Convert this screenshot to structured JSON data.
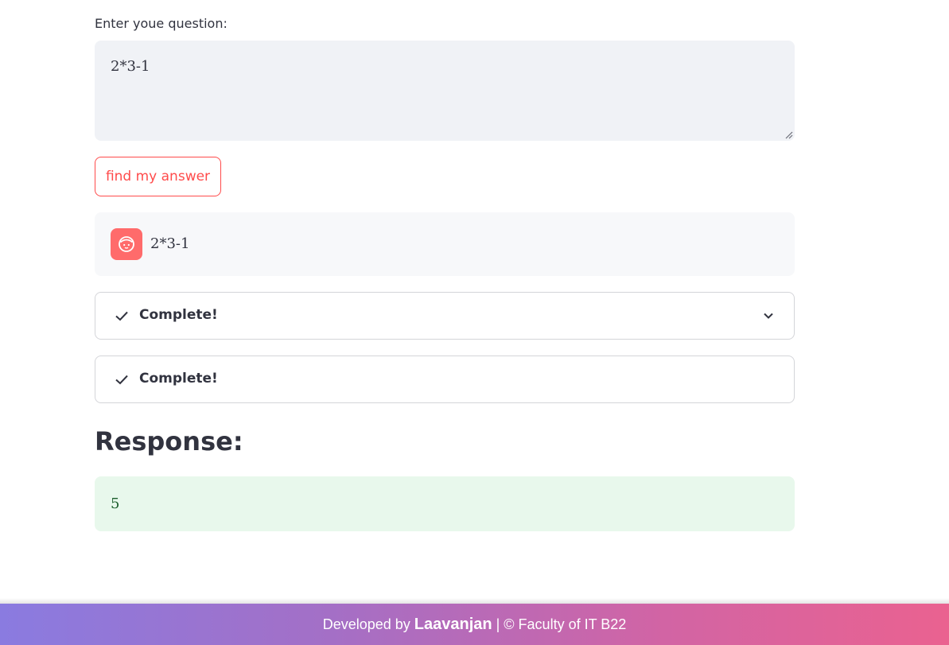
{
  "form": {
    "label": "Enter youe question:",
    "question_value": "2*3-1",
    "submit_label": "find my answer"
  },
  "chat": {
    "user_message": "2*3-1",
    "avatar_icon": "user-face-icon",
    "avatar_color": "#ff6b6b"
  },
  "status": [
    {
      "label": "Complete!",
      "icon": "check-icon",
      "expandable": true
    },
    {
      "label": "Complete!",
      "icon": "check-icon",
      "expandable": false
    }
  ],
  "response": {
    "heading": "Response:",
    "value": "5"
  },
  "footer": {
    "prefix": "Developed by",
    "author": "Laavanjan",
    "suffix": "| © Faculty of IT B22"
  },
  "colors": {
    "accent": "#ff4b4b",
    "success_bg": "#e8f8ec",
    "input_bg": "#f0f2f6"
  }
}
